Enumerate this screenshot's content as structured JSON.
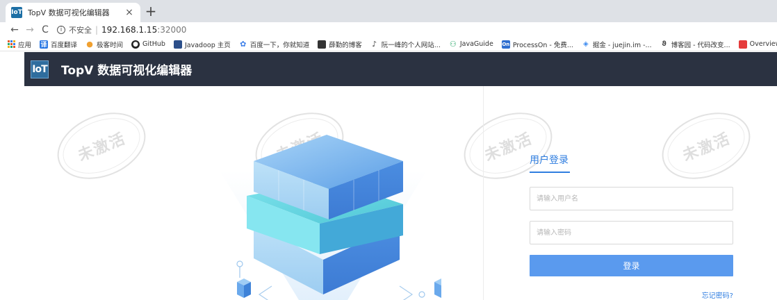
{
  "browser": {
    "tab": {
      "title": "TopV 数据可视化编辑器",
      "favicon": "IoT",
      "close": "×"
    },
    "new_tab": "+",
    "nav": {
      "back": "←",
      "forward": "→",
      "reload": "C"
    },
    "address": {
      "security_label": "不安全",
      "separator": "|",
      "host": "192.168.1.15",
      "port": ":32000"
    },
    "bookmarks": [
      {
        "icon": "apps-grid-icon",
        "label": "应用",
        "color": "#e55b2a"
      },
      {
        "icon": "translate-icon",
        "label": "百度翻译",
        "color": "#2f7be5"
      },
      {
        "icon": "location-pin-icon",
        "label": "极客时间",
        "color": "#f0a030"
      },
      {
        "icon": "github-icon",
        "label": "GitHub",
        "color": "#222222"
      },
      {
        "icon": "book-icon",
        "label": "Javadoop 主页",
        "color": "#2c4f8a"
      },
      {
        "icon": "paw-icon",
        "label": "百度一下，你就知道",
        "color": "#3b7ee8"
      },
      {
        "icon": "blog-icon",
        "label": "薛勤的博客",
        "color": "#333333"
      },
      {
        "icon": "leaf-icon",
        "label": "阮一峰的个人网站...",
        "color": "#444444"
      },
      {
        "icon": "person-icon",
        "label": "JavaGuide",
        "color": "#2aa86a"
      },
      {
        "icon": "processon-icon",
        "label": "ProcessOn - 免费...",
        "color": "#2f6fd0"
      },
      {
        "icon": "juejin-icon",
        "label": "掘金 - juejin.im -...",
        "color": "#3d8bf0"
      },
      {
        "icon": "cnblogs-icon",
        "label": "博客园 - 代码改变...",
        "color": "#444444"
      },
      {
        "icon": "overview-icon",
        "label": "Overview (Ja",
        "color": "#e53b3b"
      }
    ]
  },
  "app": {
    "logo": "IoT",
    "title": "TopV 数据可视化编辑器"
  },
  "watermark": {
    "text": "未激活"
  },
  "login": {
    "title": "用户登录",
    "username_placeholder": "请输入用户名",
    "password_placeholder": "请输入密码",
    "submit_label": "登录",
    "forgot_label": "忘记密码?"
  },
  "colors": {
    "header_bg": "#2b3241",
    "accent": "#2f7ee0",
    "button": "#5a9aee"
  }
}
